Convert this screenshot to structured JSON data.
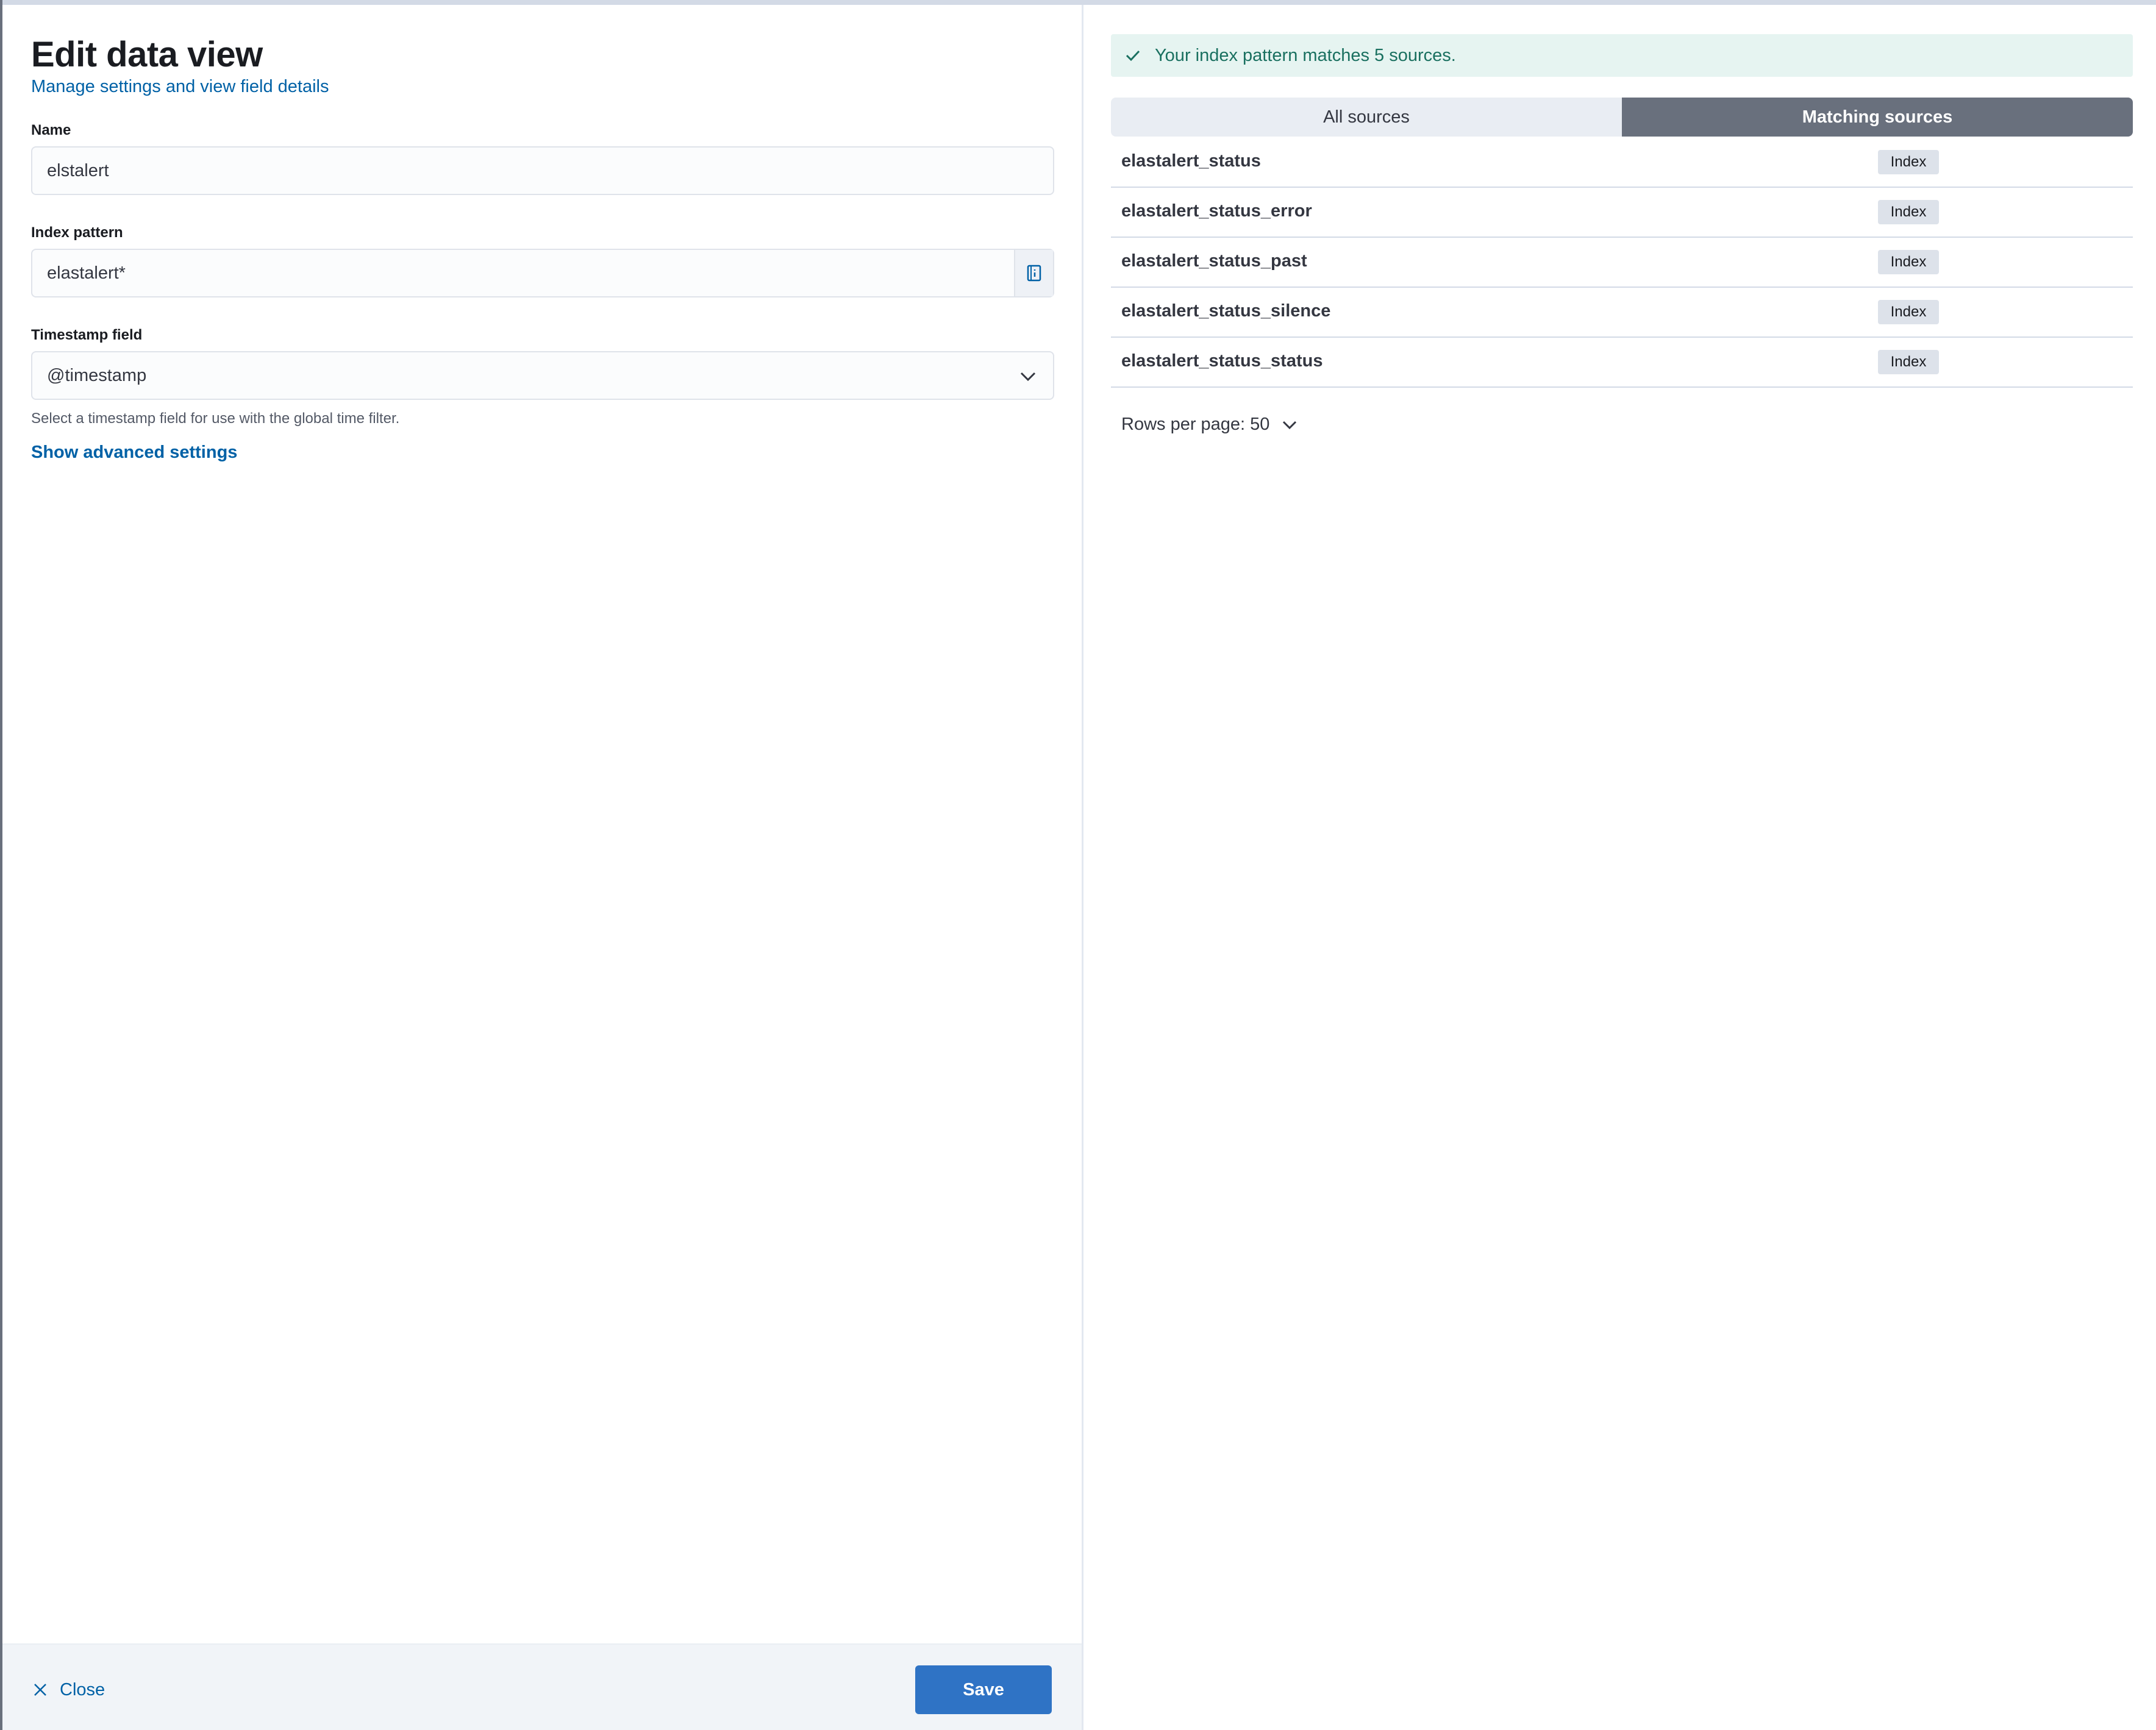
{
  "flyout": {
    "title": "Edit data view",
    "subtitle": "Manage settings and view field details"
  },
  "form": {
    "name": {
      "label": "Name",
      "value": "elstalert"
    },
    "index_pattern": {
      "label": "Index pattern",
      "value": "elastalert*",
      "append_icon": "info-book-icon"
    },
    "timestamp": {
      "label": "Timestamp field",
      "value": "@timestamp",
      "helper": "Select a timestamp field for use with the global time filter."
    },
    "advanced_link": "Show advanced settings"
  },
  "footer": {
    "close_label": "Close",
    "save_label": "Save"
  },
  "callout": {
    "text": "Your index pattern matches 5 sources.",
    "icon": "check-icon",
    "color": "#1a7060"
  },
  "tabs": [
    {
      "label": "All sources",
      "selected": false
    },
    {
      "label": "Matching sources",
      "selected": true
    }
  ],
  "sources": [
    {
      "name": "elastalert_status",
      "type": "Index"
    },
    {
      "name": "elastalert_status_error",
      "type": "Index"
    },
    {
      "name": "elastalert_status_past",
      "type": "Index"
    },
    {
      "name": "elastalert_status_silence",
      "type": "Index"
    },
    {
      "name": "elastalert_status_status",
      "type": "Index"
    }
  ],
  "pagination": {
    "rows_per_page_label": "Rows per page: 50"
  },
  "colors": {
    "primary": "#2f73c5",
    "link": "#0061a6",
    "success_bg": "#e6f4f1"
  }
}
